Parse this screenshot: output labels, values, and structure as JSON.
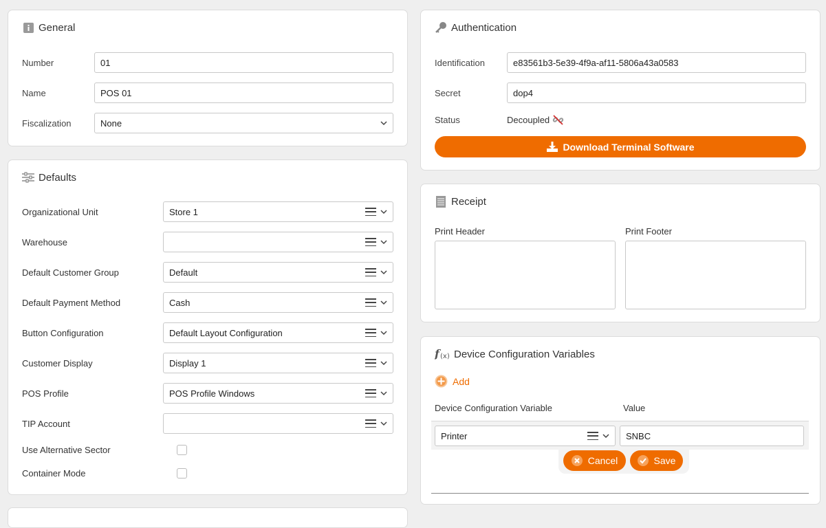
{
  "general": {
    "title": "General",
    "fields": [
      {
        "label": "Number",
        "value": "01"
      },
      {
        "label": "Name",
        "value": "POS 01"
      },
      {
        "label": "Fiscalization",
        "value": "None"
      }
    ]
  },
  "defaults": {
    "title": "Defaults",
    "fields": [
      {
        "label": "Organizational Unit",
        "value": "Store 1"
      },
      {
        "label": "Warehouse",
        "value": ""
      },
      {
        "label": "Default Customer Group",
        "value": "Default"
      },
      {
        "label": "Default Payment Method",
        "value": "Cash"
      },
      {
        "label": "Button Configuration",
        "value": "Default Layout Configuration"
      },
      {
        "label": "Customer Display",
        "value": "Display 1"
      },
      {
        "label": "POS Profile",
        "value": "POS Profile Windows"
      },
      {
        "label": "TIP Account",
        "value": ""
      }
    ],
    "checkboxes": [
      {
        "label": "Use Alternative Sector",
        "checked": false
      },
      {
        "label": "Container Mode",
        "checked": false
      }
    ]
  },
  "authentication": {
    "title": "Authentication",
    "identification_label": "Identification",
    "identification_value": "e83561b3-5e39-4f9a-af11-5806a43a0583",
    "secret_label": "Secret",
    "secret_value": "dop4",
    "status_label": "Status",
    "status_value": "Decoupled",
    "download_label": "Download Terminal Software"
  },
  "receipt": {
    "title": "Receipt",
    "header_label": "Print Header",
    "footer_label": "Print Footer"
  },
  "device_vars": {
    "title": "Device Configuration Variables",
    "add_label": "Add",
    "col_variable": "Device Configuration Variable",
    "col_value": "Value",
    "row_variable": "Printer",
    "row_value": "SNBC",
    "cancel_label": "Cancel",
    "save_label": "Save"
  },
  "colors": {
    "accent": "#ef6c00",
    "accent_light": "#f7a35c"
  }
}
